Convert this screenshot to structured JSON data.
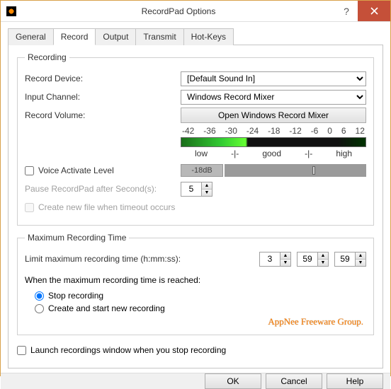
{
  "titlebar": {
    "title": "RecordPad Options"
  },
  "tabs": {
    "general": "General",
    "record": "Record",
    "output": "Output",
    "transmit": "Transmit",
    "hotkeys": "Hot-Keys"
  },
  "recording": {
    "legend": "Recording",
    "device_label": "Record Device:",
    "device_selected": "[Default Sound In]",
    "channel_label": "Input Channel:",
    "channel_selected": "Windows Record Mixer",
    "volume_label": "Record Volume:",
    "open_mixer_btn": "Open Windows Record Mixer",
    "ticks": [
      "-42",
      "-36",
      "-30",
      "-24",
      "-18",
      "-12",
      "-6",
      "0",
      "6",
      "12"
    ],
    "meter_labels": {
      "low": "low",
      "sep1": "-|-",
      "good": "good",
      "sep2": "-|-",
      "high": "high"
    },
    "voice_activate_label": "Voice Activate Level",
    "voice_activate_checked": false,
    "voice_activate_value": "-18dB",
    "pause_label": "Pause RecordPad after Second(s):",
    "pause_value": "5",
    "newfile_label": "Create new file when timeout occurs",
    "newfile_checked": false
  },
  "maxtime": {
    "legend": "Maximum Recording Time",
    "limit_label": "Limit maximum recording time (h:mm:ss):",
    "h": "3",
    "m": "59",
    "s": "59",
    "reached_label": "When the maximum recording time is reached:",
    "stop_label": "Stop recording",
    "newrec_label": "Create and start new recording",
    "radio_selected": "stop"
  },
  "launch": {
    "label": "Launch recordings window when you stop recording",
    "checked": false
  },
  "watermark": "AppNee Freeware Group.",
  "buttons": {
    "ok": "OK",
    "cancel": "Cancel",
    "help": "Help"
  }
}
